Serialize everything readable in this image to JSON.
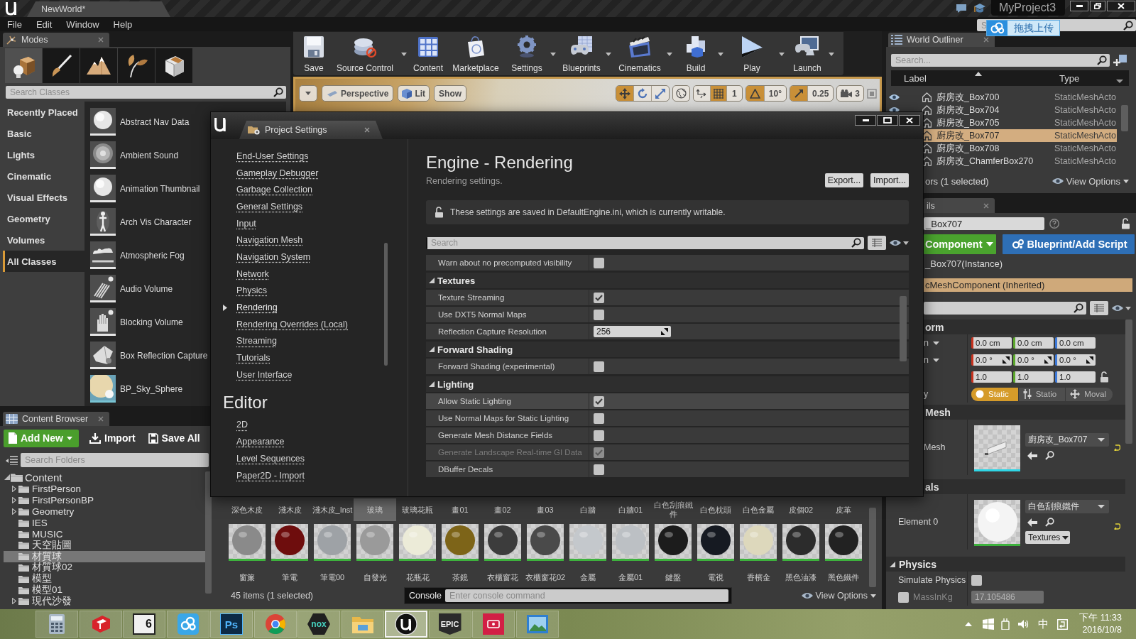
{
  "title_bar": {
    "document_tab": "NewWorld*",
    "project": "MyProject3"
  },
  "menu_bar": {
    "items": [
      "File",
      "Edit",
      "Window",
      "Help"
    ],
    "help_search": {
      "placeholder": "S"
    },
    "upload_widget": {
      "label": "拖拽上传"
    }
  },
  "modes_panel": {
    "tab": "Modes",
    "modes": [
      {
        "kind": "place",
        "selected": true
      },
      {
        "kind": "paint",
        "selected": false
      },
      {
        "kind": "landscape",
        "selected": false
      },
      {
        "kind": "foliage",
        "selected": false
      },
      {
        "kind": "geometry",
        "selected": false
      }
    ],
    "search": {
      "placeholder": "Search Classes"
    },
    "categories": [
      {
        "label": "Recently Placed",
        "selected": false
      },
      {
        "label": "Basic",
        "selected": false
      },
      {
        "label": "Lights",
        "selected": false
      },
      {
        "label": "Cinematic",
        "selected": false
      },
      {
        "label": "Visual Effects",
        "selected": false
      },
      {
        "label": "Geometry",
        "selected": false
      },
      {
        "label": "Volumes",
        "selected": false
      },
      {
        "label": "All Classes",
        "selected": true
      }
    ],
    "items": [
      {
        "label": "Abstract Nav Data",
        "kind": "sphere"
      },
      {
        "label": "Ambient Sound",
        "kind": "speaker"
      },
      {
        "label": "Animation Thumbnail",
        "kind": "sphere"
      },
      {
        "label": "Arch Vis Character",
        "kind": "figure"
      },
      {
        "label": "Atmospheric Fog",
        "kind": "fog"
      },
      {
        "label": "Audio Volume",
        "kind": "audio_volume"
      },
      {
        "label": "Blocking Volume",
        "kind": "hand"
      },
      {
        "label": "Box Reflection Capture",
        "kind": "capture"
      },
      {
        "label": "BP_Sky_Sphere",
        "kind": "sky"
      }
    ]
  },
  "toolbar": {
    "buttons": [
      {
        "label": "Save",
        "kind": "save",
        "dropdown": false
      },
      {
        "label": "Source Control",
        "kind": "source_control",
        "dropdown": true
      },
      {
        "label": "Content",
        "kind": "content",
        "dropdown": false
      },
      {
        "label": "Marketplace",
        "kind": "marketplace",
        "dropdown": false
      },
      {
        "label": "Settings",
        "kind": "settings",
        "dropdown": true
      },
      {
        "label": "Blueprints",
        "kind": "blueprints",
        "dropdown": true
      },
      {
        "label": "Cinematics",
        "kind": "cinematics",
        "dropdown": true
      },
      {
        "label": "Build",
        "kind": "build",
        "dropdown": true
      },
      {
        "label": "Play",
        "kind": "play",
        "dropdown": true
      },
      {
        "label": "Launch",
        "kind": "launch",
        "dropdown": true
      }
    ]
  },
  "viewport_toolbar": {
    "view": "Perspective",
    "view_mode": "Lit",
    "show": "Show",
    "transform_tools": [
      {
        "kind": "translate",
        "selected": true
      },
      {
        "kind": "rotate",
        "selected": false
      },
      {
        "kind": "scale",
        "selected": false
      }
    ],
    "grid_snap": {
      "on": true,
      "value": "1"
    },
    "rotation_snap": {
      "on": true,
      "value": "10°"
    },
    "scale_snap": {
      "on": true,
      "value": "0.25"
    },
    "camera_speed": "3"
  },
  "content_browser": {
    "tab": "Content Browser",
    "buttons": [
      {
        "kind": "add_new",
        "label": "Add New"
      },
      {
        "kind": "import",
        "label": "Import"
      },
      {
        "kind": "save_all",
        "label": "Save All"
      }
    ],
    "folder_search": {
      "placeholder": "Search Folders"
    },
    "tree": [
      {
        "label": "Content",
        "expanded": true,
        "selected": false,
        "children": [
          {
            "label": "FirstPerson",
            "expanded": false,
            "selected": false
          },
          {
            "label": "FirstPersonBP",
            "expanded": false,
            "selected": false
          },
          {
            "label": "Geometry",
            "expanded": false,
            "selected": false
          },
          {
            "label": "IES",
            "selected": false
          },
          {
            "label": "MUSIC",
            "selected": false
          },
          {
            "label": "天空貼圖",
            "selected": false
          },
          {
            "label": "材質球",
            "selected": true
          },
          {
            "label": "材質球02",
            "selected": false
          },
          {
            "label": "模型",
            "selected": false
          },
          {
            "label": "模型01",
            "selected": false
          },
          {
            "label": "現代沙發",
            "expanded": false,
            "selected": false
          }
        ]
      }
    ],
    "asset_grid": {
      "upper_captions": [
        {
          "label": "深色木皮",
          "selected": false
        },
        {
          "label": "淺木皮",
          "selected": false
        },
        {
          "label": "淺木皮_Inst",
          "selected": false
        },
        {
          "label": "玻璃",
          "selected": true
        },
        {
          "label": "玻璃花瓶",
          "selected": false
        },
        {
          "label": "畫01",
          "selected": false
        },
        {
          "label": "畫02",
          "selected": false
        },
        {
          "label": "畫03",
          "selected": false
        },
        {
          "label": "白牆",
          "selected": false
        },
        {
          "label": "白牆01",
          "selected": false
        },
        {
          "label": "白色刮痕鐵件",
          "selected": false
        },
        {
          "label": "白色枕頭",
          "selected": false
        },
        {
          "label": "白色金屬",
          "selected": false
        },
        {
          "label": "皮個02",
          "selected": false
        },
        {
          "label": "皮革",
          "selected": false
        }
      ],
      "tiles": [
        {
          "label": "窗簾",
          "color": "#8a8a8a"
        },
        {
          "label": "筆電",
          "color": "#6e0d0d"
        },
        {
          "label": "筆電00",
          "color": "#9ea2a6"
        },
        {
          "label": "自發光",
          "color": "#9a9a9a"
        },
        {
          "label": "花瓶花",
          "color": "#ecebd8"
        },
        {
          "label": "茶鏡",
          "color": "#7d6418"
        },
        {
          "label": "衣櫃窗花",
          "color": "#3c3c3c"
        },
        {
          "label": "衣櫃窗花02",
          "color": "#4a4a4a"
        },
        {
          "label": "金屬",
          "color": "#c4c8cc"
        },
        {
          "label": "金屬01",
          "color": "#bcc0c4"
        },
        {
          "label": "鍵盤",
          "color": "#1c1c1c"
        },
        {
          "label": "電視",
          "color": "#161a22"
        },
        {
          "label": "香檳金",
          "color": "#ddd8bc"
        },
        {
          "label": "黑色油漆",
          "color": "#2c2c2c"
        },
        {
          "label": "黑色鐵件",
          "color": "#222222"
        }
      ]
    },
    "status": "45 items (1 selected)",
    "console": {
      "label": "Console",
      "placeholder": "Enter console command"
    },
    "view_options": "View Options"
  },
  "world_outliner": {
    "tab": "World Outliner",
    "search": {
      "placeholder": "Search..."
    },
    "columns": [
      "Label",
      "Type"
    ],
    "rows": [
      {
        "label": "廚房改_Box700",
        "type": "StaticMeshActo",
        "visible": true,
        "selected": false
      },
      {
        "label": "廚房改_Box704",
        "type": "StaticMeshActo",
        "visible": true,
        "selected": false
      },
      {
        "label": "廚房改_Box705",
        "type": "StaticMeshActo",
        "selected": false
      },
      {
        "label": "廚房改_Box707",
        "type": "StaticMeshActo",
        "selected": true
      },
      {
        "label": "廚房改_Box708",
        "type": "StaticMeshActo",
        "selected": false
      },
      {
        "label": "廚房改_ChamferBox270",
        "type": "StaticMeshActo",
        "selected": false
      }
    ],
    "status": "ors (1 selected)",
    "view_options": "View Options"
  },
  "details": {
    "tab": "ils",
    "name_field": {
      "value": "_Box707"
    },
    "add_component": "Component",
    "blueprint_button": "Blueprint/Add Script",
    "components": [
      {
        "label": "_Box707(Instance)",
        "selected": false
      },
      {
        "label": "cMeshComponent (Inherited)",
        "selected": true
      }
    ],
    "sections": [
      {
        "kind": "transform",
        "title": "orm",
        "rows": [
          {
            "kind": "vector",
            "label": "n",
            "values": [
              "0.0 cm",
              "0.0 cm",
              "0.0 cm"
            ]
          },
          {
            "kind": "rotator",
            "label": "n",
            "values": [
              "0.0 °",
              "0.0 °",
              "0.0 °"
            ]
          },
          {
            "kind": "scale",
            "values": [
              "1.0",
              "1.0",
              "1.0"
            ]
          },
          {
            "kind": "mobility",
            "label": "y",
            "options": [
              {
                "kind": "static",
                "label": "Static",
                "selected": true
              },
              {
                "kind": "stationary",
                "label": "Statio",
                "selected": false
              },
              {
                "kind": "movable",
                "label": "Moval",
                "selected": false
              }
            ]
          }
        ]
      },
      {
        "kind": "asset",
        "title": "Mesh",
        "label": "Mesh",
        "asset": "廚房改_Box707"
      },
      {
        "kind": "materials",
        "title": "als",
        "label": "Element 0",
        "asset": "白色刮痕鐵件",
        "button": "Textures"
      },
      {
        "kind": "physics",
        "title": "Physics",
        "expanded": true,
        "rows": [
          {
            "kind": "checkbox",
            "label": "Simulate Physics",
            "checked": false,
            "disabled": false
          },
          {
            "kind": "override_number",
            "label": "MassInKg",
            "checked": false,
            "disabled": true,
            "value": "17.105486"
          }
        ]
      }
    ]
  },
  "project_settings": {
    "tab": "Project Settings",
    "nav": [
      {
        "items": [
          {
            "label": "End-User Settings",
            "selected": false
          },
          {
            "label": "Gameplay Debugger",
            "selected": false
          },
          {
            "label": "Garbage Collection",
            "selected": false
          },
          {
            "label": "General Settings",
            "selected": false
          },
          {
            "label": "Input",
            "selected": false
          },
          {
            "label": "Navigation Mesh",
            "selected": false
          },
          {
            "label": "Navigation System",
            "selected": false
          },
          {
            "label": "Network",
            "selected": false
          },
          {
            "label": "Physics",
            "selected": false
          },
          {
            "label": "Rendering",
            "selected": true
          },
          {
            "label": "Rendering Overrides (Local)",
            "selected": false
          },
          {
            "label": "Streaming",
            "selected": false
          },
          {
            "label": "Tutorials",
            "selected": false
          },
          {
            "label": "User Interface",
            "selected": false
          }
        ]
      },
      {
        "heading": "Editor",
        "items": [
          {
            "label": "2D",
            "selected": false
          },
          {
            "label": "Appearance",
            "selected": false
          },
          {
            "label": "Level Sequences",
            "selected": false
          },
          {
            "label": "Paper2D - Import",
            "selected": false
          }
        ]
      }
    ],
    "title": "Engine - Rendering",
    "subtitle": "Rendering settings.",
    "buttons": [
      "Export...",
      "Import..."
    ],
    "notice": "These settings are saved in DefaultEngine.ini, which is currently writable.",
    "search": {
      "placeholder": "Search"
    },
    "rows": [
      {
        "kind": "checkbox",
        "label": "Warn about no precomputed visibility",
        "checked": false,
        "disabled": false,
        "hovered": false
      },
      {
        "kind": "category",
        "label": "Textures",
        "expanded": true
      },
      {
        "kind": "checkbox",
        "label": "Texture Streaming",
        "checked": true,
        "disabled": false,
        "hovered": false
      },
      {
        "kind": "checkbox",
        "label": "Use DXT5 Normal Maps",
        "checked": false,
        "disabled": false,
        "hovered": false
      },
      {
        "kind": "number",
        "label": "Reflection Capture Resolution",
        "value": "256",
        "hovered": false
      },
      {
        "kind": "category",
        "label": "Forward Shading",
        "expanded": true
      },
      {
        "kind": "checkbox",
        "label": "Forward Shading (experimental)",
        "checked": false,
        "disabled": false,
        "hovered": false
      },
      {
        "kind": "category",
        "label": "Lighting",
        "expanded": true
      },
      {
        "kind": "checkbox",
        "label": "Allow Static Lighting",
        "checked": true,
        "disabled": false,
        "hovered": true
      },
      {
        "kind": "checkbox",
        "label": "Use Normal Maps for Static Lighting",
        "checked": false,
        "disabled": false,
        "hovered": false
      },
      {
        "kind": "checkbox",
        "label": "Generate Mesh Distance Fields",
        "checked": false,
        "disabled": false,
        "hovered": false
      },
      {
        "kind": "checkbox",
        "label": "Generate Landscape Real-time GI Data",
        "checked": true,
        "disabled": true,
        "hovered": false
      },
      {
        "kind": "checkbox",
        "label": "DBuffer Decals",
        "checked": false,
        "disabled": false,
        "hovered": false
      }
    ]
  },
  "taskbar": {
    "apps": [
      {
        "kind": "calculator",
        "active": false
      },
      {
        "kind": "sketchup",
        "active": false
      },
      {
        "kind": "v6",
        "text": "6",
        "active": false
      },
      {
        "kind": "cloud",
        "active": false
      },
      {
        "kind": "photoshop",
        "text": "Ps",
        "active": false
      },
      {
        "kind": "chrome",
        "active": false
      },
      {
        "kind": "nox",
        "text": "nox",
        "active": false
      },
      {
        "kind": "explorer",
        "active": false
      },
      {
        "kind": "unreal",
        "active": true
      },
      {
        "kind": "epic",
        "text": "EPIC",
        "active": false
      },
      {
        "kind": "recorder",
        "active": false
      },
      {
        "kind": "photos",
        "active": false
      }
    ],
    "ime": "中",
    "time": "下午 11:33",
    "date": "2016/10/8"
  }
}
